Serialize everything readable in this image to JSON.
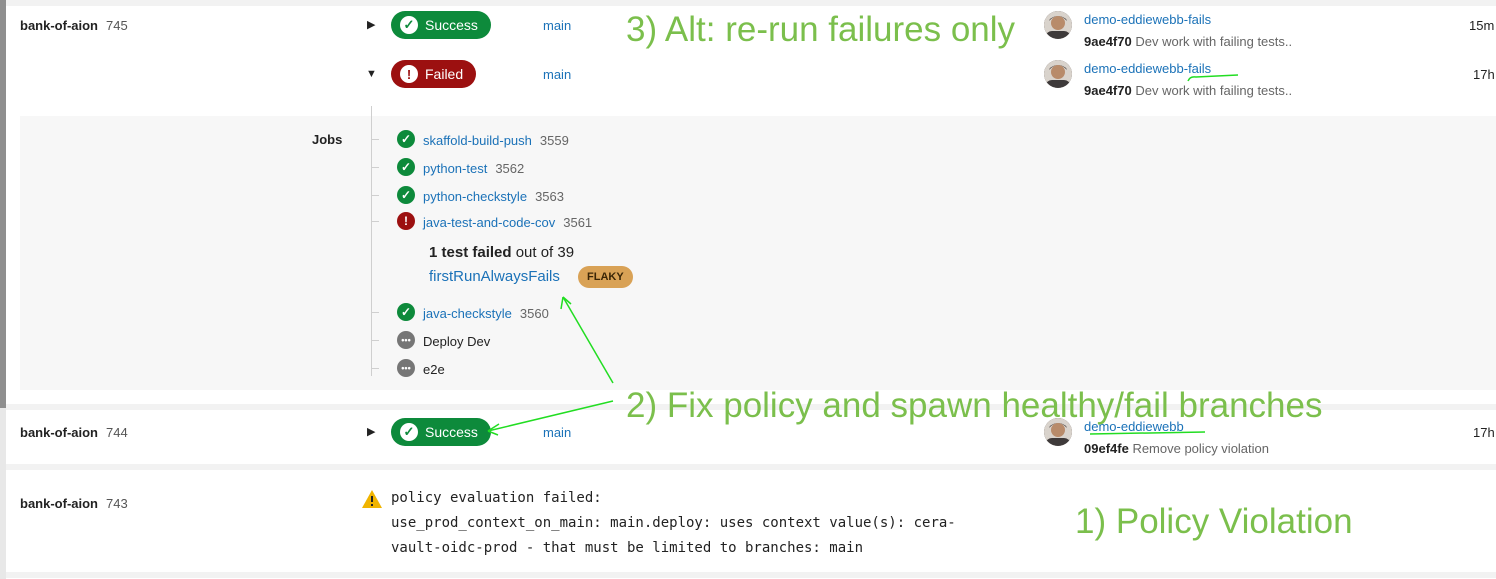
{
  "pipelines": [
    {
      "project": "bank-of-aion",
      "number": "745",
      "runs": [
        {
          "status": "Success",
          "branch": "main",
          "user": "demo-eddiewebb-fails",
          "commit_hash": "9ae4f70",
          "commit_msg": "Dev work with failing tests..",
          "time": "15m"
        },
        {
          "status": "Failed",
          "branch": "main",
          "user": "demo-eddiewebb-fails",
          "commit_hash": "9ae4f70",
          "commit_msg": "Dev work with failing tests..",
          "time": "17h"
        }
      ]
    },
    {
      "project": "bank-of-aion",
      "number": "744",
      "status": "Success",
      "branch": "main",
      "user": "demo-eddiewebb",
      "commit_hash": "09ef4fe",
      "commit_msg": "Remove policy violation",
      "time": "17h"
    },
    {
      "project": "bank-of-aion",
      "number": "743",
      "error_lines": [
        "policy evaluation failed:",
        "use_prod_context_on_main: main.deploy: uses context value(s): cera-",
        "vault-oidc-prod - that must be limited to branches: main"
      ]
    }
  ],
  "jobs": {
    "label": "Jobs",
    "items": [
      {
        "name": "skaffold-build-push",
        "number": "3559",
        "status": "success"
      },
      {
        "name": "python-test",
        "number": "3562",
        "status": "success"
      },
      {
        "name": "python-checkstyle",
        "number": "3563",
        "status": "success"
      },
      {
        "name": "java-test-and-code-cov",
        "number": "3561",
        "status": "failed"
      },
      {
        "name": "java-checkstyle",
        "number": "3560",
        "status": "success"
      },
      {
        "name": "Deploy Dev",
        "number": "",
        "status": "pending"
      },
      {
        "name": "e2e",
        "number": "",
        "status": "pending"
      }
    ],
    "test_summary_bold": "1 test failed",
    "test_summary_rest": " out of 39",
    "failed_test": "firstRunAlwaysFails",
    "flaky_label": "FLAKY"
  },
  "annotations": {
    "step1": "1) Policy Violation",
    "step2": "2) Fix policy and spawn healthy/fail branches",
    "step3": "3) Alt: re-run failures only"
  },
  "colors": {
    "success": "#0d8a3b",
    "failed": "#9c1010",
    "link": "#1b72b8",
    "annotation": "#7bbf4c",
    "arrow": "#22dd22",
    "flaky": "#d9a256"
  }
}
